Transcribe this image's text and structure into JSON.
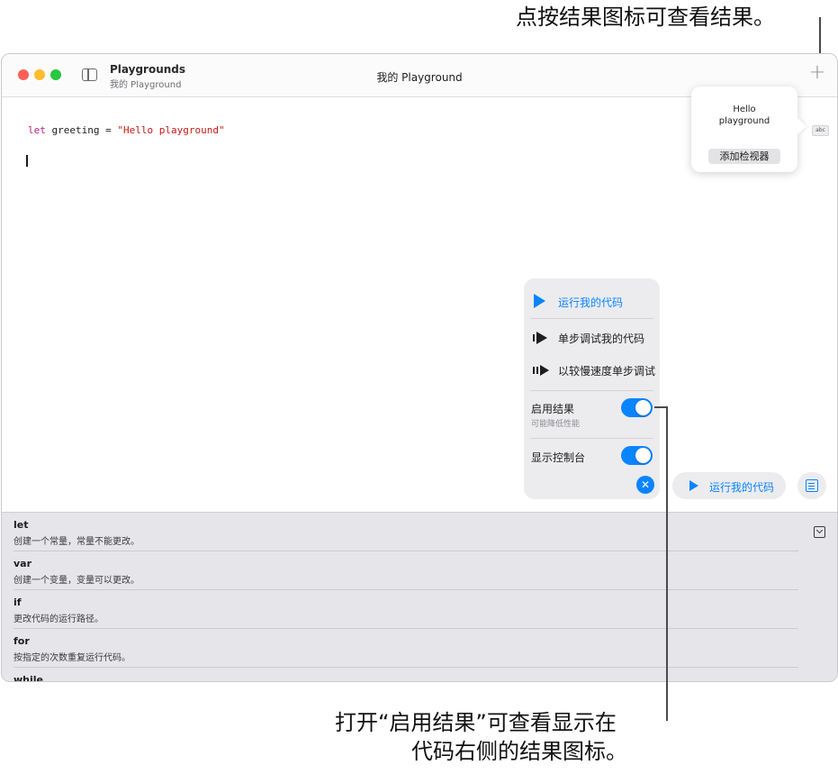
{
  "callouts": {
    "top": "点按结果图标可查看结果。",
    "bottom_line1": "打开“启用结果”可查看显示在",
    "bottom_line2": "代码右侧的结果图标。"
  },
  "window": {
    "app_name": "Playgrounds",
    "app_subtitle": "我的 Playground",
    "doc_title": "我的 Playground",
    "traffic_lights": {
      "close": "#ff5f57",
      "minimize": "#febc2e",
      "zoom": "#28c840"
    },
    "plus_icon": "+"
  },
  "editor": {
    "code": {
      "keyword": "let",
      "rest": " greeting = ",
      "string": "\"Hello playground\""
    }
  },
  "result_popover": {
    "value": "Hello playground",
    "add_viewer_label": "添加检视器",
    "badge": "abc"
  },
  "run_menu": {
    "items": [
      {
        "label": "运行我的代码",
        "icon": "play-icon"
      },
      {
        "label": "单步调试我的代码",
        "icon": "step-icon"
      },
      {
        "label": "以较慢速度单步调试",
        "icon": "slow-step-icon"
      }
    ],
    "toggles": [
      {
        "label": "启用结果",
        "sub": "可能降低性能",
        "on": true
      },
      {
        "label": "显示控制台",
        "sub": "",
        "on": true
      }
    ],
    "close_icon": "✕"
  },
  "run_button": {
    "label": "运行我的代码"
  },
  "keywords": [
    {
      "title": "let",
      "desc": "创建一个常量，常量不能更改。"
    },
    {
      "title": "var",
      "desc": "创建一个变量，变量可以更改。"
    },
    {
      "title": "if",
      "desc": "更改代码的运行路径。"
    },
    {
      "title": "for",
      "desc": "按指定的次数重复运行代码。"
    },
    {
      "title": "while",
      "desc": ""
    }
  ],
  "colors": {
    "accent": "#0a84ff",
    "keyword": "#b3227d",
    "string": "#c41a16"
  }
}
